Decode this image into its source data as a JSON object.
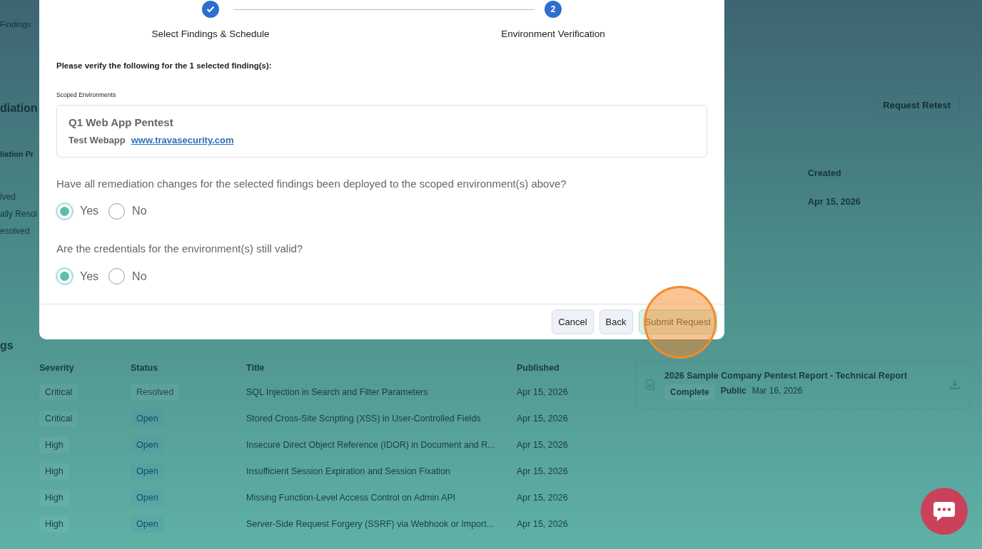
{
  "background_page": {
    "stat_label": "Findings",
    "section_title": "diation",
    "subsection_title": "liation Pr",
    "status_list": [
      "lved",
      "ally Resol",
      "esolved"
    ],
    "request_retest_button": "Request Retest",
    "retest_table": {
      "columns": [
        "Created"
      ],
      "rows": [
        [
          "Apr 15, 2026"
        ]
      ]
    },
    "findings_title": "gs",
    "findings_table": {
      "columns": [
        "Severity",
        "Status",
        "Title",
        "Published"
      ],
      "rows": [
        {
          "severity": "Critical",
          "status": {
            "text": "Resolved",
            "kind": "resolved"
          },
          "title": "SQL Injection in Search and Filter Parameters",
          "published": "Apr 15, 2026"
        },
        {
          "severity": "Critical",
          "status": {
            "text": "Open",
            "kind": "open"
          },
          "title": "Stored Cross-Site Scripting (XSS) in User-Controlled Fields",
          "published": "Apr 15, 2026"
        },
        {
          "severity": "High",
          "status": {
            "text": "Open",
            "kind": "open"
          },
          "title": "Insecure Direct Object Reference (IDOR) in Document and R...",
          "published": "Apr 15, 2026"
        },
        {
          "severity": "High",
          "status": {
            "text": "Open",
            "kind": "open"
          },
          "title": "Insufficient Session Expiration and Session Fixation",
          "published": "Apr 15, 2026"
        },
        {
          "severity": "High",
          "status": {
            "text": "Open",
            "kind": "open"
          },
          "title": "Missing Function-Level Access Control on Admin API",
          "published": "Apr 15, 2026"
        },
        {
          "severity": "High",
          "status": {
            "text": "Open",
            "kind": "open"
          },
          "title": "Server-Side Request Forgery (SSRF) via Webhook or Import...",
          "published": "Apr 15, 2026"
        }
      ]
    },
    "report": {
      "title": "2026 Sample Company Pentest Report - Technical Report",
      "status": "Complete",
      "visibility": "Public",
      "date": "Mar 16, 2026"
    }
  },
  "modal": {
    "steps": [
      {
        "label": "Select Findings & Schedule",
        "completed": true
      },
      {
        "label": "Environment Verification",
        "number": "2",
        "completed": false
      }
    ],
    "instruction": "Please verify the following for the 1 selected finding(s):",
    "scoped_label": "Scoped Environments",
    "environment": {
      "name": "Q1 Web App Pentest",
      "type": "Test Webapp",
      "url": "www.travasecurity.com"
    },
    "questions": [
      {
        "text": "Have all remediation changes for the selected findings been deployed to the scoped environment(s) above?",
        "options": [
          {
            "label": "Yes",
            "selected": true
          },
          {
            "label": "No",
            "selected": false
          }
        ]
      },
      {
        "text": "Are the credentials for the environment(s) still valid?",
        "options": [
          {
            "label": "Yes",
            "selected": true
          },
          {
            "label": "No",
            "selected": false
          }
        ]
      }
    ],
    "buttons": [
      {
        "label": "Cancel",
        "kind": "secondary"
      },
      {
        "label": "Back",
        "kind": "secondary"
      },
      {
        "label": "Submit Request",
        "kind": "primary"
      }
    ]
  }
}
